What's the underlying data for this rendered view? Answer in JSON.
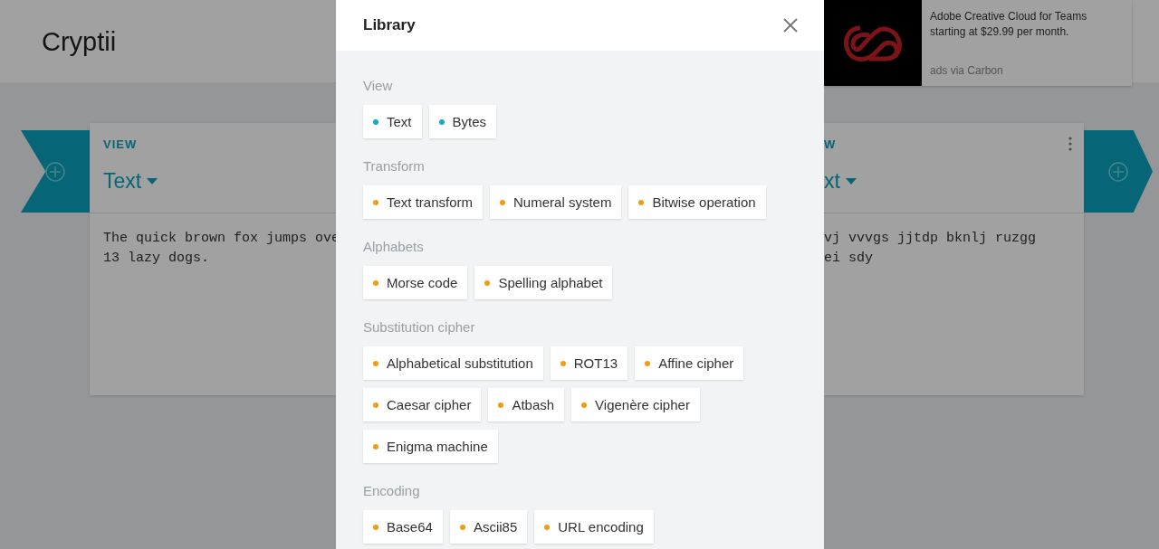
{
  "app": {
    "title": "Cryptii"
  },
  "ad": {
    "text": "Adobe Creative Cloud for Teams starting at $29.99 per month.",
    "credit": "ads via Carbon"
  },
  "bricks": [
    {
      "label": "VIEW",
      "encoder": "Text",
      "content": [
        "The quick brown fox jumps ove",
        "13 lazy dogs."
      ]
    },
    {
      "label": "W",
      "encoder": "xt",
      "content": [
        "vj vvvgs jjtdp bknlj ruzgg",
        "ei sdy"
      ]
    }
  ],
  "library": {
    "title": "Library",
    "sections": [
      {
        "title": "View",
        "items": [
          {
            "label": "Text",
            "color": "#16a8c6"
          },
          {
            "label": "Bytes",
            "color": "#16a8c6"
          }
        ]
      },
      {
        "title": "Transform",
        "items": [
          {
            "label": "Text transform",
            "color": "#f39c12"
          },
          {
            "label": "Numeral system",
            "color": "#f39c12"
          },
          {
            "label": "Bitwise operation",
            "color": "#f39c12"
          }
        ]
      },
      {
        "title": "Alphabets",
        "items": [
          {
            "label": "Morse code",
            "color": "#f39c12"
          },
          {
            "label": "Spelling alphabet",
            "color": "#f39c12"
          }
        ]
      },
      {
        "title": "Substitution cipher",
        "items": [
          {
            "label": "Alphabetical substitution",
            "color": "#f39c12"
          },
          {
            "label": "ROT13",
            "color": "#f39c12"
          },
          {
            "label": "Affine cipher",
            "color": "#f39c12"
          },
          {
            "label": "Caesar cipher",
            "color": "#f39c12"
          },
          {
            "label": "Atbash",
            "color": "#f39c12"
          },
          {
            "label": "Vigenère cipher",
            "color": "#f39c12"
          },
          {
            "label": "Enigma machine",
            "color": "#f39c12"
          }
        ]
      },
      {
        "title": "Encoding",
        "items": [
          {
            "label": "Base64",
            "color": "#f39c12"
          },
          {
            "label": "Ascii85",
            "color": "#f39c12"
          },
          {
            "label": "URL encoding",
            "color": "#f39c12"
          }
        ]
      }
    ]
  }
}
